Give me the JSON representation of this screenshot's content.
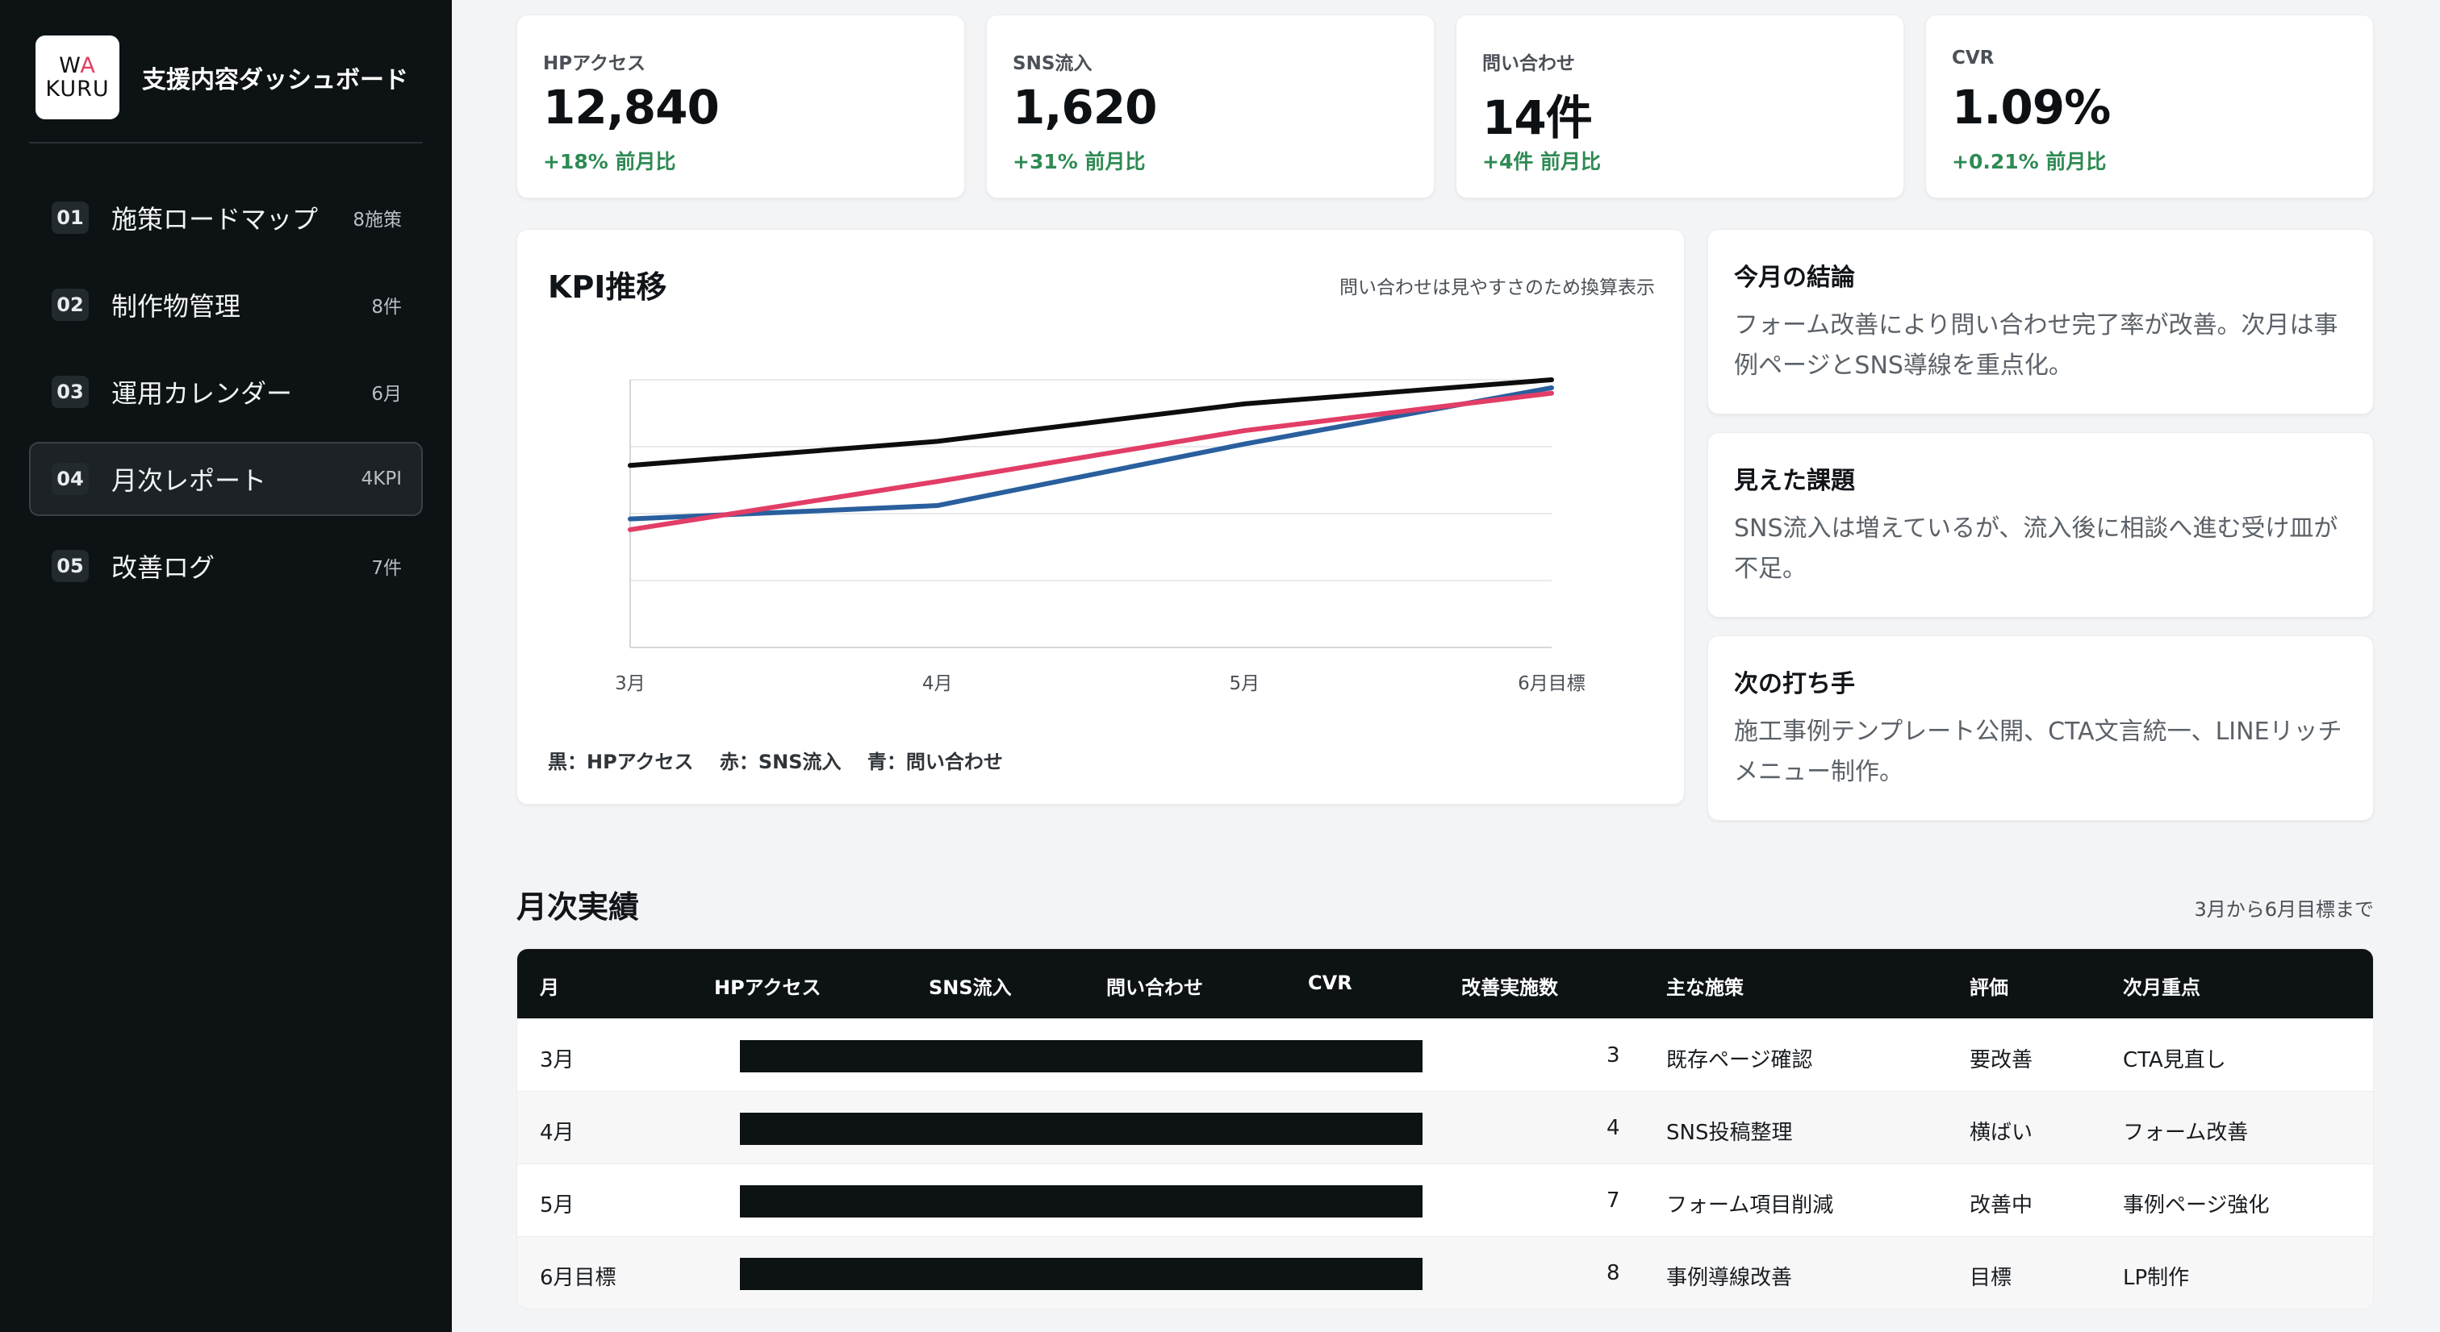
{
  "sidebar": {
    "logo": {
      "line1_w": "W",
      "line1_a": "A",
      "line2": "KURU"
    },
    "title": "支援内容ダッシュボード",
    "items": [
      {
        "num": "01",
        "label": "施策ロードマップ",
        "meta": "8施策",
        "active": false
      },
      {
        "num": "02",
        "label": "制作物管理",
        "meta": "8件",
        "active": false
      },
      {
        "num": "03",
        "label": "運用カレンダー",
        "meta": "6月",
        "active": false
      },
      {
        "num": "04",
        "label": "月次レポート",
        "meta": "4KPI",
        "active": true
      },
      {
        "num": "05",
        "label": "改善ログ",
        "meta": "7件",
        "active": false
      }
    ]
  },
  "kpis": [
    {
      "label": "HPアクセス",
      "value": "12,840",
      "delta": "+18% 前月比"
    },
    {
      "label": "SNS流入",
      "value": "1,620",
      "delta": "+31% 前月比"
    },
    {
      "label": "問い合わせ",
      "value": "14件",
      "delta": "+4件 前月比"
    },
    {
      "label": "CVR",
      "value": "1.09%",
      "delta": "+0.21% 前月比"
    }
  ],
  "kpi_chart": {
    "title": "KPI推移",
    "note": "問い合わせは見やすさのため換算表示",
    "legend": "黒：HPアクセス　 赤：SNS流入　 青：問い合わせ",
    "colors": {
      "black": "#0d0d0d",
      "red": "#e23d66",
      "blue": "#2a5f9e"
    }
  },
  "chart_data": {
    "type": "line",
    "categories": [
      "3月",
      "4月",
      "5月",
      "6月目標"
    ],
    "ylim": [
      0,
      100
    ],
    "grid": true,
    "series": [
      {
        "values": [
          68,
          77,
          91,
          100
        ],
        "color": "#0d0d0d"
      },
      {
        "values": [
          44,
          62,
          81,
          95
        ],
        "color": "#e23d66"
      },
      {
        "values": [
          48,
          53,
          76,
          97
        ],
        "color": "#2a5f9e"
      }
    ]
  },
  "insights": [
    {
      "title": "今月の結論",
      "body": "フォーム改善により問い合わせ完了率が改善。次月は事例ページとSNS導線を重点化。"
    },
    {
      "title": "見えた課題",
      "body": "SNS流入は増えているが、流入後に相談へ進む受け皿が不足。"
    },
    {
      "title": "次の打ち手",
      "body": "施工事例テンプレート公開、CTA文言統一、LINEリッチメニュー制作。"
    }
  ],
  "monthly": {
    "title": "月次実績",
    "note": "3月から6月目標まで",
    "headers": [
      "月",
      "HPアクセス",
      "SNS流入",
      "問い合わせ",
      "CVR",
      "改善実施数",
      "主な施策",
      "評価",
      "次月重点"
    ],
    "rows": [
      {
        "month": "3月",
        "count": "3",
        "measure": "既存ページ確認",
        "rating": "要改善",
        "next": "CTA見直し"
      },
      {
        "month": "4月",
        "count": "4",
        "measure": "SNS投稿整理",
        "rating": "横ばい",
        "next": "フォーム改善"
      },
      {
        "month": "5月",
        "count": "7",
        "measure": "フォーム項目削減",
        "rating": "改善中",
        "next": "事例ページ強化"
      },
      {
        "month": "6月目標",
        "count": "8",
        "measure": "事例導線改善",
        "rating": "目標",
        "next": "LP制作"
      }
    ]
  }
}
